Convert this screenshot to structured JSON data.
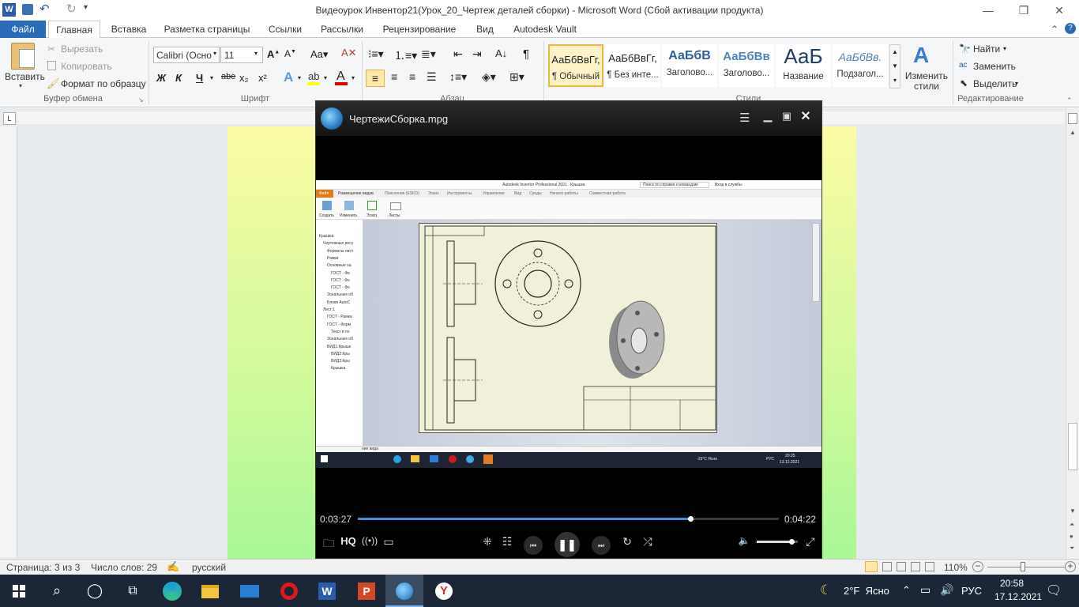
{
  "window": {
    "title": "Видеоурок Инвентор21(Урок_20_Чертеж деталей сборки)  -  Microsoft Word (Сбой активации продукта)",
    "qat_undo": "↶",
    "qat_redo": "↻"
  },
  "tabs": [
    {
      "label": "Файл"
    },
    {
      "label": "Главная"
    },
    {
      "label": "Вставка"
    },
    {
      "label": "Разметка страницы"
    },
    {
      "label": "Ссылки"
    },
    {
      "label": "Рассылки"
    },
    {
      "label": "Рецензирование"
    },
    {
      "label": "Вид"
    },
    {
      "label": "Autodesk Vault"
    }
  ],
  "clipboard": {
    "paste": "Вставить",
    "cut": "Вырезать",
    "copy": "Копировать",
    "format_painter": "Формат по образцу",
    "group": "Буфер обмена"
  },
  "font": {
    "family": "Calibri (Осно",
    "size": "11",
    "group": "Шрифт",
    "bold": "Ж",
    "italic": "К",
    "underline": "Ч",
    "strike": "abe",
    "sub": "x₂",
    "sup": "x²"
  },
  "paragraph": {
    "group": "Абзац"
  },
  "styles": {
    "group": "Стили",
    "items": [
      {
        "sample": "АаБбВвГг,",
        "name": "¶ Обычный"
      },
      {
        "sample": "АаБбВвГг,",
        "name": "¶ Без инте..."
      },
      {
        "sample": "АаБбВ",
        "name": "Заголово..."
      },
      {
        "sample": "АаБбВв",
        "name": "Заголово..."
      },
      {
        "sample": "АаБ",
        "name": "Название"
      },
      {
        "sample": "АаБбВв.",
        "name": "Подзагол..."
      }
    ],
    "change": "Изменить стили"
  },
  "editing": {
    "group": "Редактирование",
    "find": "Найти",
    "replace": "Заменить",
    "select": "Выделить"
  },
  "player": {
    "title": "ЧертежиСборка.mpg",
    "elapsed": "0:03:27",
    "total": "0:04:22",
    "progress": 0.79,
    "hq": "HQ",
    "volume": 0.85
  },
  "video": {
    "app_title": "Autodesk Inventor Professional 2021 · Крышка",
    "search": "Поиск по справке и командам",
    "login": "Вход в службы",
    "tabs": [
      "Файл",
      "Размещение видов",
      "Пояснение (ЕSKD)",
      "Эскиз",
      "Инструменты",
      "Управление",
      "Вид",
      "Среды",
      "Начало работы",
      "Совместная работа"
    ],
    "tools": [
      "Создать",
      "Изменить",
      "Эскиз",
      "Листы"
    ],
    "tree": [
      "Крышка",
      "Чертежные ресу",
      "Форматы лист",
      "Рамки",
      "Основные на",
      "ГОСТ - Фо",
      "ГОСТ - Фо",
      "ГОСТ - Фо",
      "Зональные об",
      "Блоки AutoC",
      "Лист:1",
      "ГОСТ - Рамка",
      "ГОСТ - Форм",
      "Текст в по",
      "Зональные об",
      "ВИД1:Крышк",
      "ВИД2:Кры",
      "ВИД3:Кры",
      "Крышка"
    ],
    "status": "ние вида",
    "weather": "-15°C Ясно",
    "lang": "РУС",
    "time": "20:25",
    "date": "13.12.2021"
  },
  "statusbar": {
    "page": "Страница: 3 из 3",
    "words": "Число слов: 29",
    "language": "русский",
    "zoom": "110%"
  },
  "taskbar": {
    "weather": "2°F  Ясно",
    "lang": "РУС",
    "time": "20:58",
    "date": "17.12.2021"
  },
  "colors": {
    "accent": "#2a6bb8",
    "progress": "#3d8fd8",
    "taskbar": "#1b2636"
  }
}
